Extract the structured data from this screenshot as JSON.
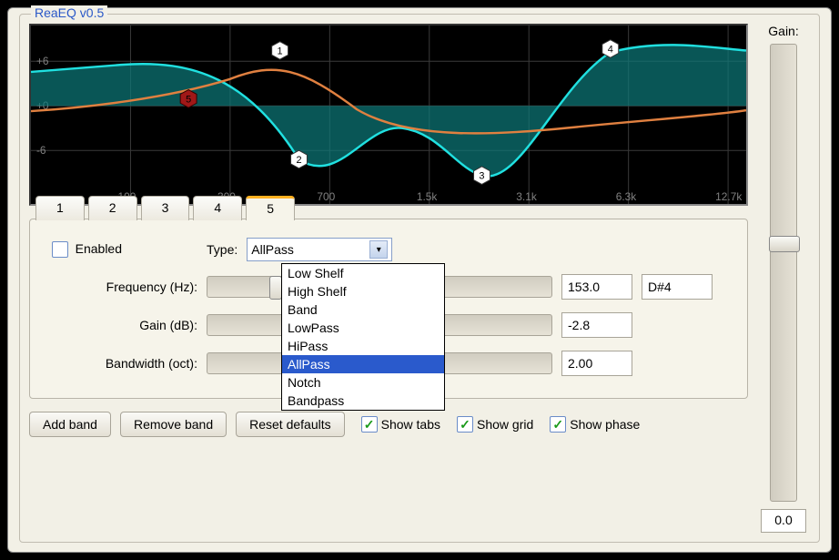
{
  "title": "ReaEQ v0.5",
  "graph": {
    "y_ticks": [
      "+6",
      "+0",
      "-6"
    ],
    "x_ticks": [
      "100",
      "300",
      "700",
      "1.5k",
      "3.1k",
      "6.3k",
      "12.7k"
    ],
    "markers": [
      {
        "id": "1",
        "x": 275,
        "y": 28
      },
      {
        "id": "2",
        "x": 296,
        "y": 150
      },
      {
        "id": "3",
        "x": 498,
        "y": 168
      },
      {
        "id": "4",
        "x": 640,
        "y": 26
      },
      {
        "id": "5",
        "x": 174,
        "y": 82,
        "sel": true
      }
    ]
  },
  "tabs": [
    "1",
    "2",
    "3",
    "4",
    "5"
  ],
  "active_tab": "5",
  "enabled_label": "Enabled",
  "enabled_checked": false,
  "type_label": "Type:",
  "type_value": "AllPass",
  "type_options": [
    "Low Shelf",
    "High Shelf",
    "Band",
    "LowPass",
    "HiPass",
    "AllPass",
    "Notch",
    "Bandpass"
  ],
  "freq": {
    "label": "Frequency (Hz):",
    "value": "153.0",
    "note": "D#4",
    "thumb_pct": 18
  },
  "gain": {
    "label": "Gain (dB):",
    "value": "-2.8",
    "thumb_pct": 44
  },
  "bw": {
    "label": "Bandwidth (oct):",
    "value": "2.00",
    "thumb_pct": 40
  },
  "buttons": {
    "add": "Add band",
    "remove": "Remove band",
    "reset": "Reset defaults"
  },
  "checks": {
    "show_tabs": {
      "label": "Show tabs",
      "checked": true
    },
    "show_grid": {
      "label": "Show grid",
      "checked": true
    },
    "show_phase": {
      "label": "Show phase",
      "checked": true
    }
  },
  "master_gain": {
    "label": "Gain:",
    "value": "0.0",
    "thumb_pct": 42
  }
}
